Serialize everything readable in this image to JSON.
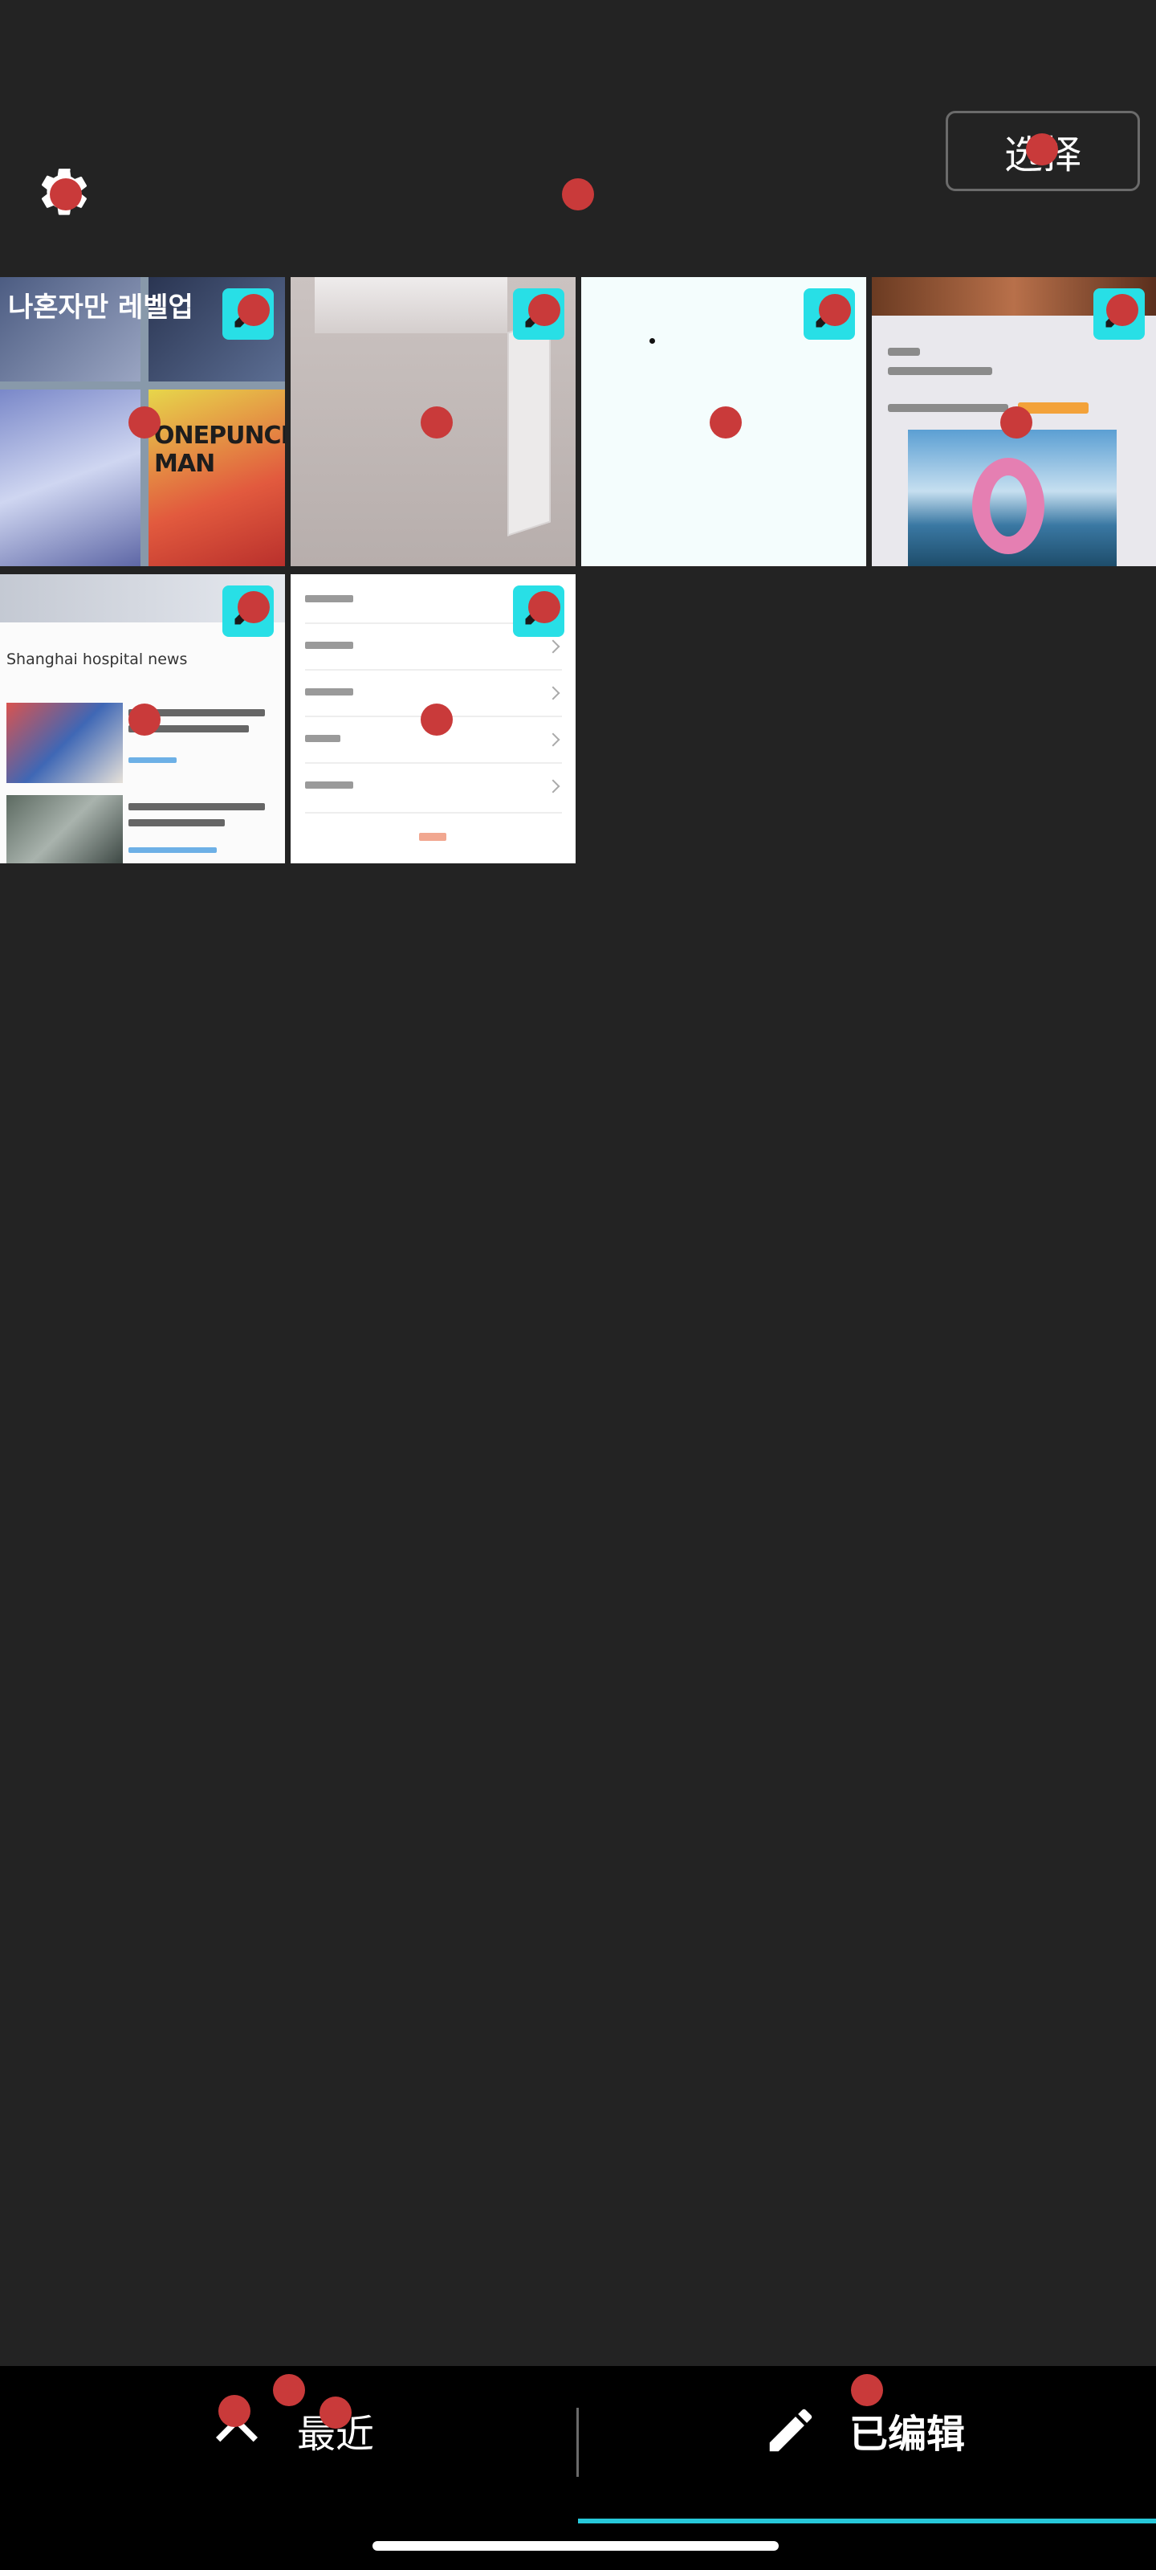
{
  "header": {
    "settings_icon": "gear-icon",
    "select_label": "选择"
  },
  "grid": {
    "badge_icon": "edit-badge-icon",
    "badge_color": "#28dfe6",
    "thumbnails": [
      {
        "name": "manga-collage",
        "overlay_text_1": "나혼자만 레벨업",
        "overlay_text_2": "ONEPUNCH-MAN"
      },
      {
        "name": "room-ceiling-ac"
      },
      {
        "name": "blank-page"
      },
      {
        "name": "travel-article"
      },
      {
        "name": "news-article",
        "overlay_text_1": "Shanghai hospital news"
      },
      {
        "name": "settings-list"
      }
    ]
  },
  "bottom_nav": {
    "recent_label": "最近",
    "recent_icon": "chevron-up-icon",
    "edited_label": "已编辑",
    "edited_icon": "pencil-icon",
    "active_tab": "已编辑",
    "accent_color": "#27c8da"
  },
  "markers": {
    "color": "#c93a3a"
  }
}
